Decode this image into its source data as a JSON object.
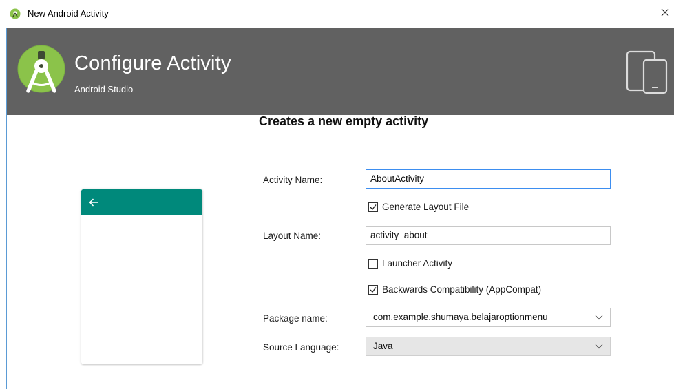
{
  "window": {
    "title": "New Android Activity",
    "close_glyph": "✕"
  },
  "header": {
    "title": "Configure Activity",
    "subtitle": "Android Studio"
  },
  "form": {
    "heading": "Creates a new empty activity",
    "activity_name": {
      "label": "Activity Name:",
      "value": "AboutActivity"
    },
    "generate_layout": {
      "label": "Generate Layout File",
      "checked": true
    },
    "layout_name": {
      "label": "Layout Name:",
      "value": "activity_about"
    },
    "launcher_activity": {
      "label": "Launcher Activity",
      "checked": false
    },
    "backwards_compat": {
      "label": "Backwards Compatibility (AppCompat)",
      "checked": true
    },
    "package_name": {
      "label": "Package name:",
      "value": "com.example.shumaya.belajaroptionmenu"
    },
    "source_language": {
      "label": "Source Language:",
      "value": "Java"
    }
  },
  "colors": {
    "header_bg": "#616161",
    "preview_bar": "#00897b",
    "focus_border": "#3d8ef0",
    "logo_green": "#8bc34a"
  }
}
